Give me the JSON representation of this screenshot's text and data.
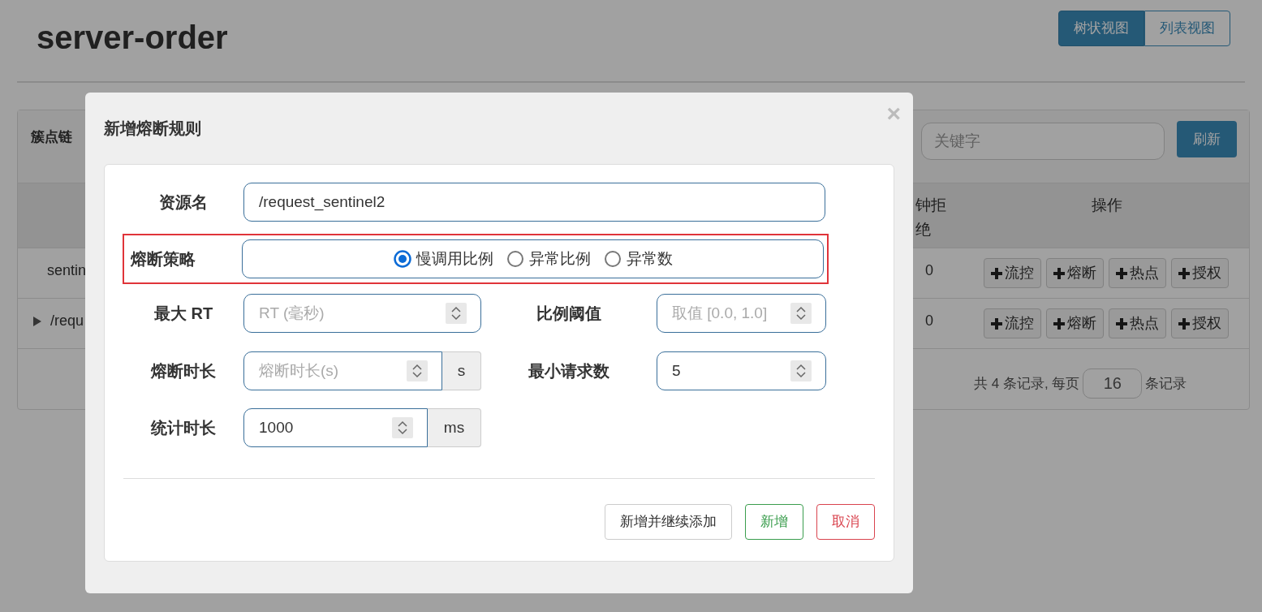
{
  "page": {
    "title": "server-order",
    "view_tabs": [
      {
        "label": "树状视图",
        "selected": true
      },
      {
        "label": "列表视图",
        "selected": false
      }
    ]
  },
  "panel": {
    "title": "簇点链",
    "search": {
      "placeholder": "关键字"
    },
    "refresh_button": "刷新",
    "columns": [
      "钟拒绝",
      "操作"
    ],
    "rows": [
      {
        "name": "sentin",
        "expandable": false,
        "value": "0",
        "actions": [
          "流控",
          "熔断",
          "热点",
          "授权"
        ]
      },
      {
        "name": "/requ",
        "expandable": true,
        "value": "0",
        "actions": [
          "流控",
          "熔断",
          "热点",
          "授权"
        ]
      }
    ],
    "pagination": {
      "prefix": "共 4 条记录, 每页",
      "page_size": "16",
      "suffix": "条记录"
    }
  },
  "modal": {
    "title": "新增熔断规则",
    "close": "×",
    "resource": {
      "label": "资源名",
      "value": "/request_sentinel2"
    },
    "strategy": {
      "label": "熔断策略",
      "highlighted": true,
      "options": [
        {
          "label": "慢调用比例",
          "selected": true
        },
        {
          "label": "异常比例",
          "selected": false
        },
        {
          "label": "异常数",
          "selected": false
        }
      ]
    },
    "max_rt": {
      "label": "最大 RT",
      "placeholder": "RT (毫秒)"
    },
    "ratio": {
      "label": "比例阈值",
      "placeholder": "取值 [0.0, 1.0]"
    },
    "duration": {
      "label": "熔断时长",
      "placeholder": "熔断时长(s)",
      "unit": "s"
    },
    "min_requests": {
      "label": "最小请求数",
      "value": "5"
    },
    "stat_interval": {
      "label": "统计时长",
      "value": "1000",
      "unit": "ms"
    },
    "buttons": [
      {
        "label": "新增并继续添加",
        "kind": "default"
      },
      {
        "label": "新增",
        "kind": "success"
      },
      {
        "label": "取消",
        "kind": "danger"
      }
    ]
  }
}
